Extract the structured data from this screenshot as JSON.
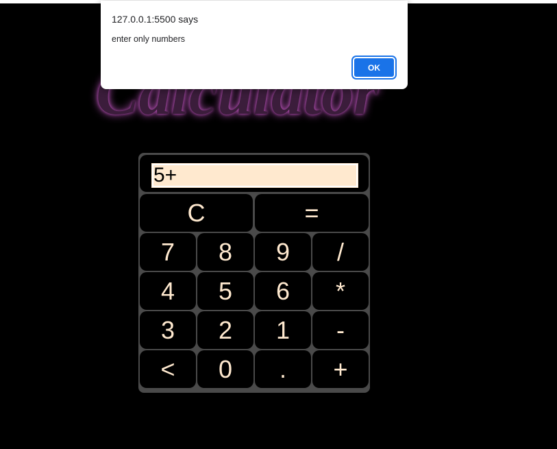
{
  "heading": {
    "text": "Calculator"
  },
  "display": {
    "value": "5+"
  },
  "keys": {
    "clear": "C",
    "equals": "=",
    "seven": "7",
    "eight": "8",
    "nine": "9",
    "divide": "/",
    "four": "4",
    "five": "5",
    "six": "6",
    "multiply": "*",
    "three": "3",
    "two": "2",
    "one": "1",
    "minus": "-",
    "backspace": "<",
    "zero": "0",
    "dot": ".",
    "plus": "+"
  },
  "alert": {
    "title": "127.0.0.1:5500 says",
    "message": "enter only numbers",
    "ok_label": "OK",
    "button_color": "#1a73e8"
  },
  "colors": {
    "page_background": "#000000",
    "panel": "#4a4a4a",
    "key_background": "#000000",
    "key_text": "#ffe9cf",
    "display_background": "#ffe9cf",
    "heading": "#3b1d3b"
  }
}
